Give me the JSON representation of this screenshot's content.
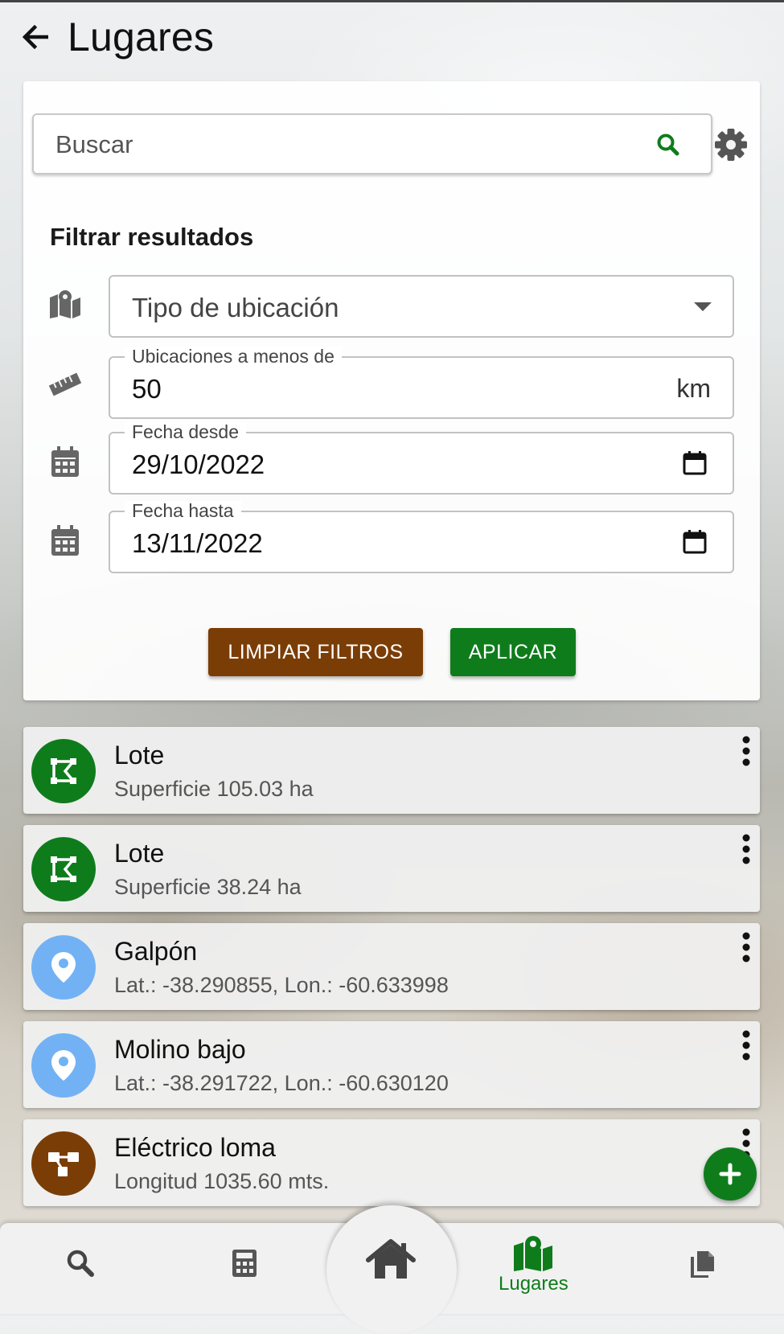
{
  "header": {
    "title": "Lugares",
    "back_icon": "arrow-left-icon"
  },
  "search": {
    "placeholder": "Buscar",
    "value": "",
    "search_icon": "search-icon",
    "settings_icon": "gear-icon"
  },
  "filters": {
    "title": "Filtrar resultados",
    "location_type": {
      "placeholder": "Tipo de ubicación",
      "icon": "map-marker-icon"
    },
    "distance": {
      "label": "Ubicaciones a menos de",
      "value": "50",
      "unit": "km",
      "icon": "ruler-icon"
    },
    "date_from": {
      "label": "Fecha desde",
      "value": "29/10/2022",
      "icon": "calendar-icon"
    },
    "date_to": {
      "label": "Fecha hasta",
      "value": "13/11/2022",
      "icon": "calendar-icon"
    },
    "clear_button": "LIMPIAR FILTROS",
    "apply_button": "APLICAR"
  },
  "places": [
    {
      "title": "Lote",
      "subtitle": "Superficie 105.03 ha",
      "icon": "polygon-icon",
      "color": "#0f7c1c"
    },
    {
      "title": "Lote",
      "subtitle": "Superficie 38.24 ha",
      "icon": "polygon-icon",
      "color": "#0f7c1c"
    },
    {
      "title": "Galpón",
      "subtitle": "Lat.: -38.290855, Lon.: -60.633998",
      "icon": "map-pin-icon",
      "color": "#72b2f4"
    },
    {
      "title": "Molino bajo",
      "subtitle": "Lat.: -38.291722, Lon.: -60.630120",
      "icon": "map-pin-icon",
      "color": "#72b2f4"
    },
    {
      "title": "Eléctrico loma",
      "subtitle": "Longitud 1035.60 mts.",
      "icon": "line-network-icon",
      "color": "#7b3d06"
    }
  ],
  "fab": {
    "icon": "plus-icon"
  },
  "bottom_nav": {
    "active_label": "Lugares",
    "items": [
      "search-icon",
      "calculator-icon",
      "home-icon",
      "map-marker-icon",
      "documents-icon"
    ]
  },
  "colors": {
    "primary_green": "#0f7c1c",
    "brown": "#7b3d06",
    "light_blue": "#72b2f4"
  }
}
